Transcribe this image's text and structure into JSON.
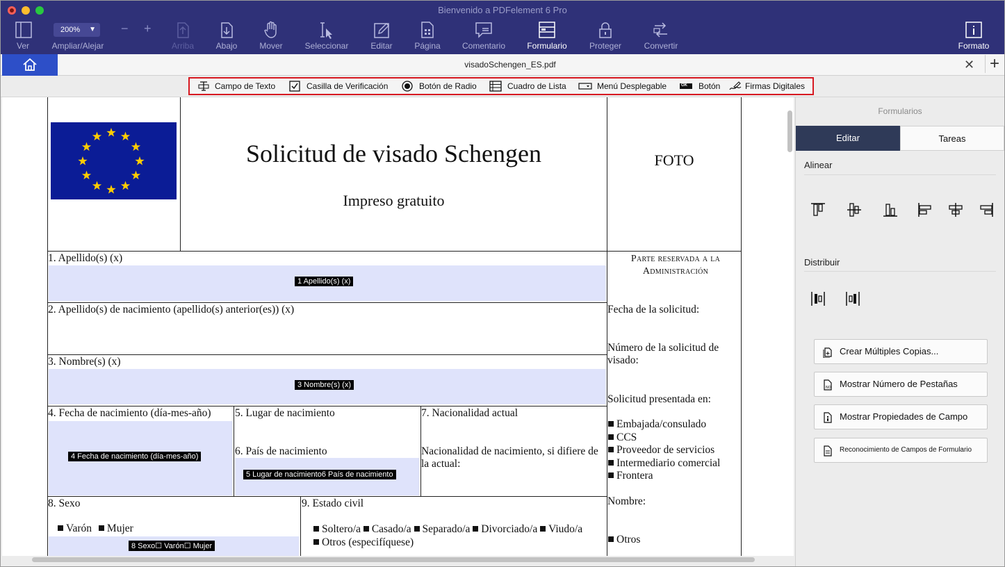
{
  "window": {
    "title": "Bienvenido a PDFelement 6 Pro"
  },
  "toolbar": {
    "zoom_value": "200%",
    "items": {
      "ver": "Ver",
      "zoom": "Ampliar/Alejar",
      "arriba": "Arriba",
      "abajo": "Abajo",
      "mover": "Mover",
      "seleccionar": "Seleccionar",
      "editar": "Editar",
      "pagina": "Página",
      "comentario": "Comentario",
      "formulario": "Formulario",
      "proteger": "Proteger",
      "convertir": "Convertir",
      "formato": "Formato"
    },
    "active_item": "Formulario"
  },
  "tab": {
    "filename": "visadoSchengen_ES.pdf"
  },
  "form_tools": {
    "text_field": "Campo de Texto",
    "checkbox": "Casilla de Verificación",
    "radio": "Botón de Radio",
    "list_box": "Cuadro de Lista",
    "dropdown": "Menú Desplegable",
    "button": "Botón",
    "button_icon_text": "OK",
    "signatures": "Firmas Digitales"
  },
  "document": {
    "title": "Solicitud de visado Schengen",
    "subtitle": "Impreso gratuito",
    "photo": "FOTO",
    "admin_header_line1": "Parte reservada a la",
    "admin_header_line2": "Administración",
    "admin": {
      "fecha_solicitud": "Fecha de la solicitud:",
      "numero_solicitud": "Número de la solicitud de visado:",
      "presentada_en": "Solicitud presentada en:",
      "options": [
        "Embajada/consulado",
        "CCS",
        "Proveedor de servicios",
        "Intermediario comercial",
        "Frontera"
      ],
      "nombre": "Nombre:",
      "otros": "Otros"
    },
    "fields": {
      "f1_label": "1. Apellido(s) (x)",
      "f1_tag": "1  Apellido(s) (x)",
      "f2_label": "2. Apellido(s) de nacimiento (apellido(s) anterior(es)) (x)",
      "f3_label": "3. Nombre(s) (x)",
      "f3_tag": "3  Nombre(s) (x)",
      "f4_label": "4. Fecha de nacimiento (día-mes-año)",
      "f4_tag": "4  Fecha de nacimiento (día-mes-año)",
      "f5_label": "5. Lugar de nacimiento",
      "f6_label": "6. País de nacimiento",
      "f56_tag": "5  Lugar de nacimiento6  País de nacimiento",
      "f7_label": "7. Nacionalidad actual",
      "f7_sub": "Nacionalidad de nacimiento, si difiere de la actual:",
      "f8_label": "8. Sexo",
      "f8_opt1": "Varón",
      "f8_opt2": "Mujer",
      "f8_tag": "8  Sexo☐ Varón☐ Mujer",
      "f9_label": "9. Estado civil",
      "f9_opts_line1": [
        "Soltero/a",
        "Casado/a",
        "Separado/a",
        "Divorciado/a",
        "Viudo/a"
      ],
      "f9_opt_line2": "Otros (especifíquese)"
    }
  },
  "right_panel": {
    "title": "Formularios",
    "tab_edit": "Editar",
    "tab_tasks": "Tareas",
    "align_heading": "Alinear",
    "distribute_heading": "Distribuir",
    "buttons": {
      "copies": "Crear Múltiples Copias...",
      "tab_numbers": "Mostrar Número de Pestañas",
      "properties": "Mostrar Propiedades de Campo",
      "recognition": "Reconocimiento de Campos de Formulario"
    }
  },
  "colors": {
    "toolbar_bg": "#2f3178",
    "home_tab": "#2d4fc8",
    "field_highlight": "#dfe3fb",
    "tools_outline": "#d71921",
    "panel_tab_active": "#2f3a58"
  }
}
